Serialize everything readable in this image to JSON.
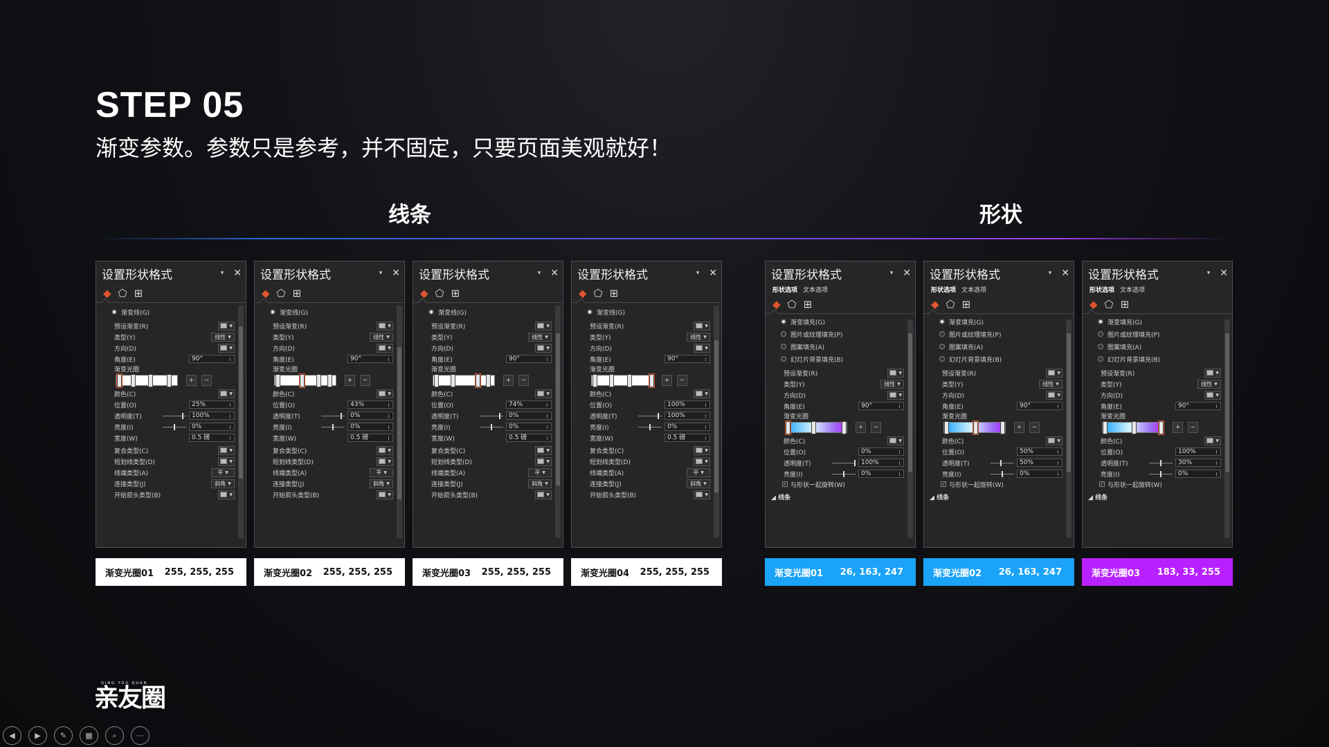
{
  "title": "STEP 05",
  "subtitle": "渐变参数。参数只是参考，并不固定，只要页面美观就好！",
  "sections": {
    "line": "线条",
    "shape": "形状"
  },
  "panel_common": {
    "title": "设置形状格式",
    "dropdown": "▾",
    "close": "✕",
    "tab_shape": "形状选项",
    "tab_text": "文本选项",
    "fill_icon": "paint-bucket-icon",
    "effects_icon": "pentagon-icon",
    "size_icon": "size-layout-icon"
  },
  "line_labels": {
    "gradient_line": "渐变线(G)",
    "preset": "预设渐变(R)",
    "type": "类型(Y)",
    "type_value": "线性",
    "direction": "方向(D)",
    "angle": "角度(E)",
    "angle_value": "90°",
    "stops": "渐变光圈",
    "color": "颜色(C)",
    "position": "位置(O)",
    "transparency": "透明度(T)",
    "brightness": "亮度(I)",
    "width": "宽度(W)",
    "width_value": "0.5 磅",
    "compound": "复合类型(C)",
    "dash": "短划线类型(D)",
    "cap": "线端类型(A)",
    "cap_value": "平",
    "join": "连接类型(J)",
    "join_value": "斜角",
    "arrow": "开始箭头类型(B)"
  },
  "shape_labels": {
    "gradient_fill": "渐变填充(G)",
    "picture_fill": "图片或纹理填充(P)",
    "pattern_fill": "图案填充(A)",
    "slide_bg_fill": "幻灯片背景填充(B)",
    "rotate_with_shape": "与形状一起旋转(W)",
    "line_section": "线条"
  },
  "line_panels": [
    {
      "position": "25%",
      "transparency": "100%",
      "brightness": "0%"
    },
    {
      "position": "43%",
      "transparency": "0%",
      "brightness": "0%"
    },
    {
      "position": "74%",
      "transparency": "0%",
      "brightness": "0%"
    },
    {
      "position": "100%",
      "transparency": "100%",
      "brightness": "0%"
    }
  ],
  "shape_panels": [
    {
      "position": "0%",
      "transparency": "100%",
      "brightness": "0%"
    },
    {
      "position": "50%",
      "transparency": "50%",
      "brightness": "0%"
    },
    {
      "position": "100%",
      "transparency": "30%",
      "brightness": "0%"
    }
  ],
  "caption_labels": [
    {
      "name": "渐变光圈01",
      "rgb": "255, 255, 255"
    },
    {
      "name": "渐变光圈02",
      "rgb": "255, 255, 255"
    },
    {
      "name": "渐变光圈03",
      "rgb": "255, 255, 255"
    },
    {
      "name": "渐变光圈04",
      "rgb": "255, 255, 255"
    },
    {
      "name": "渐变光圈01",
      "rgb": "26, 163, 247"
    },
    {
      "name": "渐变光圈02",
      "rgb": "26, 163, 247"
    },
    {
      "name": "渐变光圈03",
      "rgb": "183, 33, 255"
    }
  ],
  "label_colors": [
    "#ffffff",
    "#ffffff",
    "#ffffff",
    "#ffffff",
    "#1aa3f7",
    "#1aa3f7",
    "#b721ff"
  ],
  "logo": {
    "text": "亲友圈",
    "small": "QING YOU QUAN"
  },
  "toolbar": [
    {
      "icon": "previous-icon",
      "glyph": "◀"
    },
    {
      "icon": "next-icon",
      "glyph": "▶"
    },
    {
      "icon": "pen-icon",
      "glyph": "✎"
    },
    {
      "icon": "slides-grid-icon",
      "glyph": "▦"
    },
    {
      "icon": "zoom-icon",
      "glyph": "⌕"
    },
    {
      "icon": "more-icon",
      "glyph": "⋯"
    }
  ]
}
